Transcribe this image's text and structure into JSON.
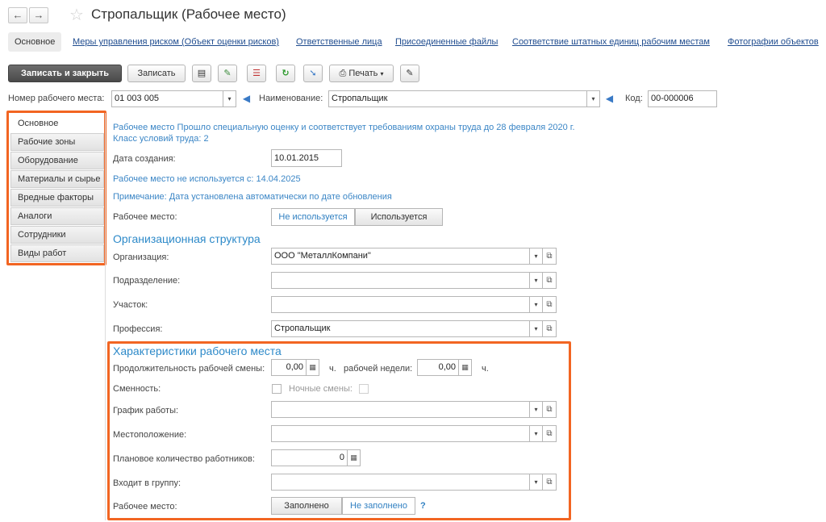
{
  "window": {
    "title": "Стропальщик (Рабочее место)"
  },
  "nav": {
    "back": "←",
    "forward": "→"
  },
  "tabs": {
    "active": "Основное",
    "links": [
      "Меры управления риском (Объект оценки рисков)",
      "Ответственные лица",
      "Присоединенные файлы",
      "Соответствие штатных единиц рабочим местам",
      "Фотографии объектов"
    ]
  },
  "toolbar": {
    "save_close": "Записать и закрыть",
    "save": "Записать",
    "print": "Печать"
  },
  "header": {
    "number_label": "Номер рабочего места:",
    "number_value": "01 003 005",
    "name_label": "Наименование:",
    "name_value": "Стропальщик",
    "code_label": "Код:",
    "code_value": "00-000006"
  },
  "sidebar": {
    "items": [
      {
        "label": "Основное"
      },
      {
        "label": "Рабочие зоны"
      },
      {
        "label": "Оборудование"
      },
      {
        "label": "Материалы и сырье"
      },
      {
        "label": "Вредные факторы"
      },
      {
        "label": "Аналоги"
      },
      {
        "label": "Сотрудники"
      },
      {
        "label": "Виды работ"
      }
    ]
  },
  "main": {
    "assessment_line1": "Рабочее место Прошло специальную оценку и соответствует требованиям охраны труда до 28 февраля 2020 г.",
    "assessment_line2": "Класс условий труда: 2",
    "created_label": "Дата создания:",
    "created_value": "10.01.2015",
    "unused_note": "Рабочее место не используется с: 14.04.2025",
    "remark": "Примечание: Дата установлена автоматически по дате обновления",
    "workplace_label": "Рабочее место:",
    "usage_options": [
      "Не используется",
      "Используется"
    ],
    "org_section": "Организационная структура",
    "org_label": "Организация:",
    "org_value": "ООО \"МеталлКомпани\"",
    "subdivision_label": "Подразделение:",
    "subdivision_value": "",
    "site_label": "Участок:",
    "site_value": "",
    "profession_label": "Профессия:",
    "profession_value": "Стропальщик",
    "char_section": "Характеристики рабочего места",
    "shift_duration_label": "Продолжительность рабочей смены:",
    "shift_duration_value": "0,00",
    "hours_unit": "ч.",
    "week_label": "рабочей недели:",
    "week_value": "0,00",
    "shifts_label": "Сменность:",
    "night_shifts_label": "Ночные смены:",
    "schedule_label": "График работы:",
    "schedule_value": "",
    "location_label": "Местоположение:",
    "location_value": "",
    "planned_label": "Плановое количество работников:",
    "planned_value": "0",
    "group_label": "Входит в группу:",
    "group_value": "",
    "filled_label": "Рабочее место:",
    "filled_options": [
      "Заполнено",
      "Не заполнено"
    ],
    "help": "?"
  }
}
